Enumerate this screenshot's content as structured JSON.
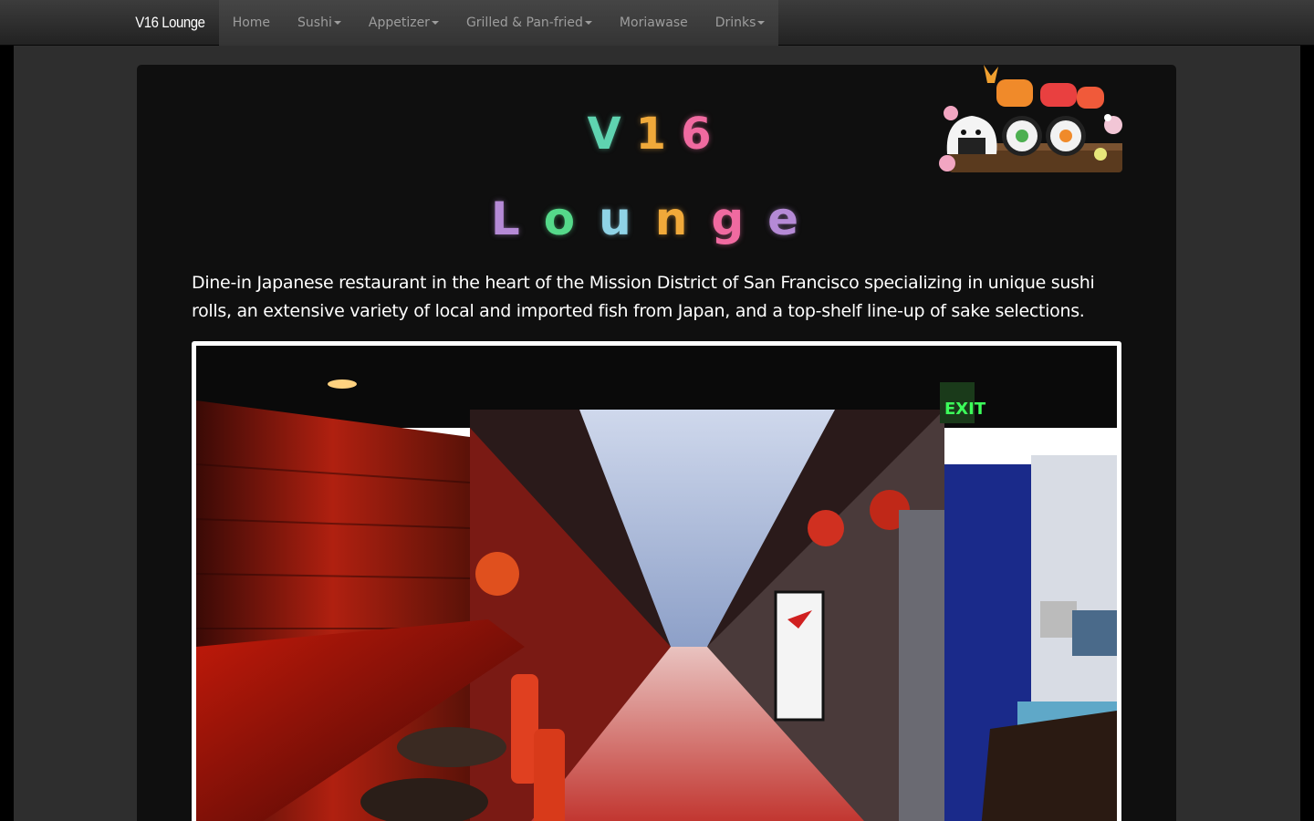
{
  "navbar": {
    "brand": "V16 Lounge",
    "items": [
      {
        "label": "Home",
        "dropdown": false
      },
      {
        "label": "Sushi",
        "dropdown": true
      },
      {
        "label": "Appetizer",
        "dropdown": true
      },
      {
        "label": "Grilled & Pan-fried",
        "dropdown": true
      },
      {
        "label": "Moriawase",
        "dropdown": false
      },
      {
        "label": "Drinks",
        "dropdown": true
      }
    ]
  },
  "hero": {
    "title_line1": [
      {
        "char": "V",
        "color": "#5fd3b0"
      },
      {
        "char": "1",
        "color": "#f0a93a"
      },
      {
        "char": "6",
        "color": "#f06aa0"
      }
    ],
    "title_line2": [
      {
        "char": "L",
        "color": "#b58ad6"
      },
      {
        "char": "o",
        "color": "#55d98a"
      },
      {
        "char": "u",
        "color": "#8fd3e6"
      },
      {
        "char": "n",
        "color": "#f0a93a"
      },
      {
        "char": "g",
        "color": "#f06aa0"
      },
      {
        "char": "e",
        "color": "#b58ad6"
      }
    ],
    "tagline": "Dine-in Japanese restaurant in the heart of the Mission District of San Francisco specializing in unique sushi rolls, an extensive variety of local and imported fish from Japan, and a top-shelf line-up of sake selections."
  },
  "colors": {
    "navbar_text": "#9d9d9d",
    "brand_text": "#ffffff",
    "panel_bg": "#0f0f0f",
    "page_bg": "#2e2e2e"
  },
  "icons": {
    "sushi_art": "kawaii-sushi-illustration",
    "photo": "restaurant-interior-photo"
  }
}
